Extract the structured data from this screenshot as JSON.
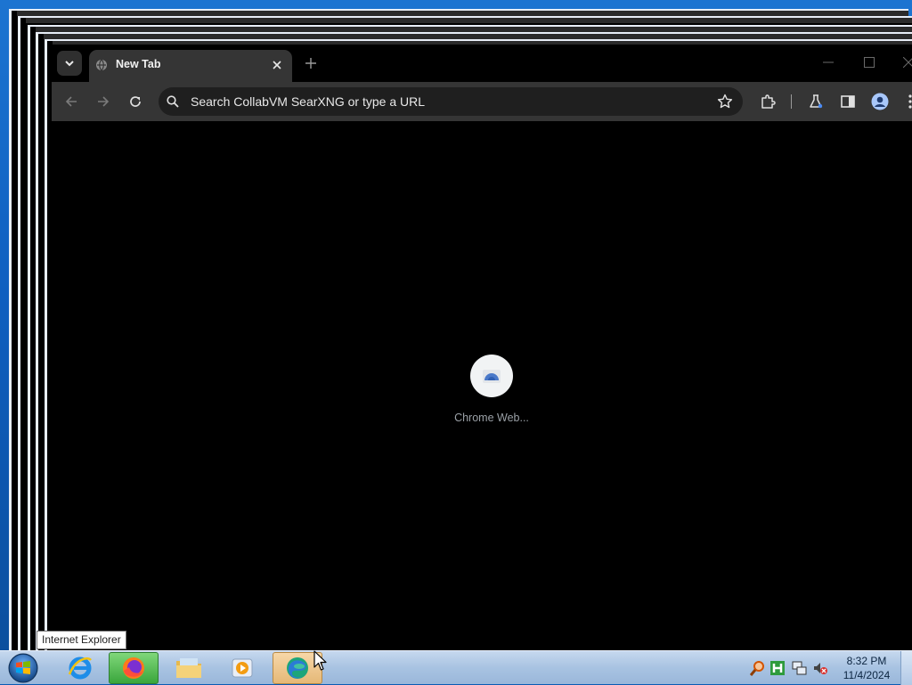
{
  "browser": {
    "tab_title": "New Tab",
    "omnibox_placeholder": "Search CollabVM SearXNG or type a URL",
    "shortcuts": [
      {
        "label": "Chrome Web...",
        "icon": "chrome-web-store-icon"
      }
    ]
  },
  "tooltip": {
    "text": "Internet Explorer"
  },
  "taskbar": {
    "items": [
      {
        "name": "internet-explorer",
        "icon": "ie-icon"
      },
      {
        "name": "firefox",
        "icon": "firefox-icon"
      },
      {
        "name": "file-explorer",
        "icon": "folder-icon"
      },
      {
        "name": "media-player",
        "icon": "media-player-icon"
      },
      {
        "name": "edge-browser",
        "icon": "edge-icon"
      }
    ],
    "clock": {
      "time": "8:32 PM",
      "date": "11/4/2024"
    }
  }
}
